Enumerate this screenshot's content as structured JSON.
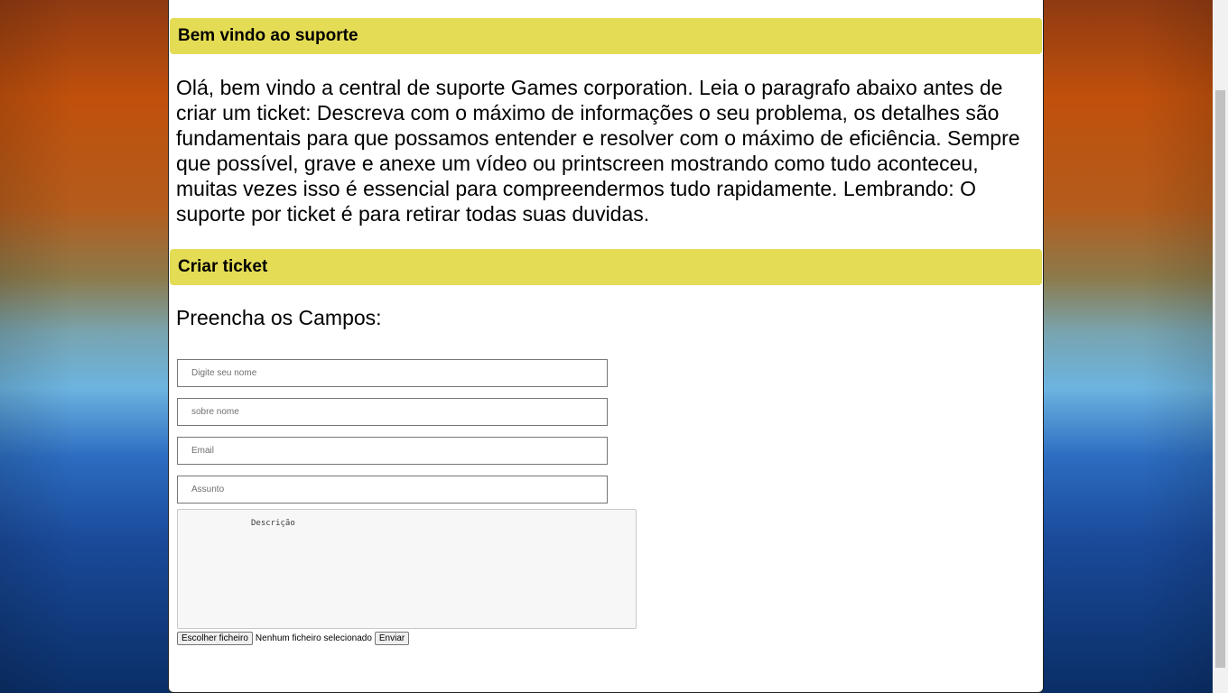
{
  "welcome_section": {
    "header": "Bem vindo ao suporte",
    "intro_text": "Olá, bem vindo a central de suporte Games corporation. Leia o paragrafo abaixo antes de criar um ticket: Descreva com o máximo de informações o seu problema, os detalhes são fundamentais para que possamos entender e resolver com o máximo de eficiência. Sempre que possível, grave e anexe um vídeo ou printscreen mostrando como tudo aconteceu, muitas vezes isso é essencial para compreendermos tudo rapidamente. Lembrando: O suporte por ticket é para retirar todas suas duvidas."
  },
  "ticket_section": {
    "header": "Criar ticket",
    "form_title": "Preencha os Campos:",
    "fields": {
      "name_placeholder": "Digite seu nome",
      "surname_placeholder": "sobre nome",
      "email_placeholder": "Email",
      "subject_placeholder": "Assunto",
      "description_placeholder": "Descrição"
    },
    "file_button_label": "Escolher ficheiro",
    "file_status": "Nenhum ficheiro selecionado",
    "submit_label": "Enviar"
  }
}
